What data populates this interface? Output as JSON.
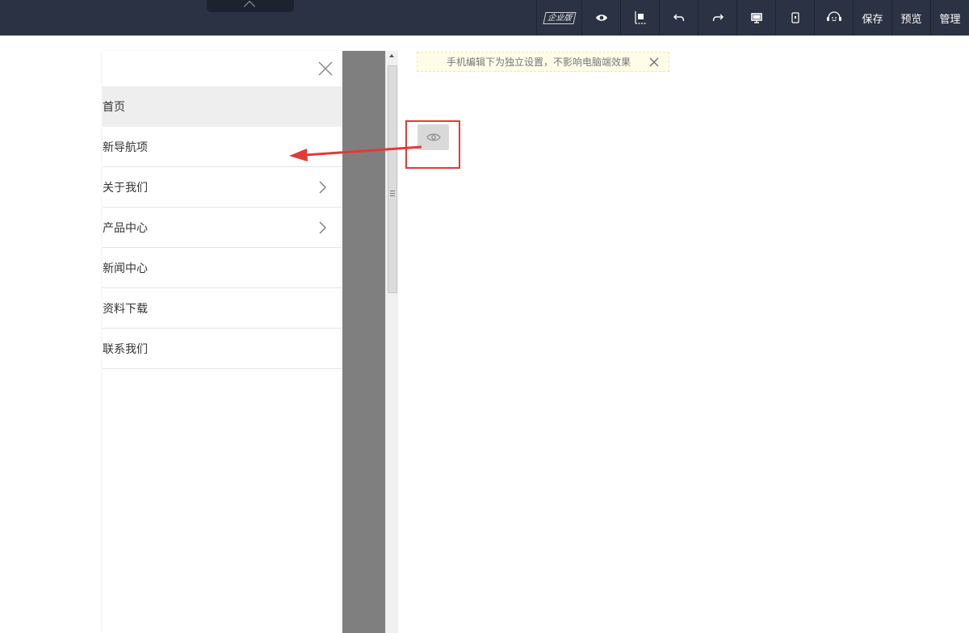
{
  "toolbar": {
    "badge_label": "企业版",
    "save_label": "保存",
    "preview_label": "预览",
    "manage_label": "管理"
  },
  "icons": {
    "eye": "eye-icon",
    "layout": "layout-icon",
    "undo": "undo-icon",
    "redo": "redo-icon",
    "desktop": "desktop-icon",
    "mobile": "mobile-icon",
    "support": "support-icon"
  },
  "nav": {
    "items": [
      {
        "label": "首页",
        "active": true,
        "has_arrow": false
      },
      {
        "label": "新导航项",
        "active": false,
        "has_arrow": false
      },
      {
        "label": "关于我们",
        "active": false,
        "has_arrow": true
      },
      {
        "label": "产品中心",
        "active": false,
        "has_arrow": true
      },
      {
        "label": "新闻中心",
        "active": false,
        "has_arrow": false
      },
      {
        "label": "资料下载",
        "active": false,
        "has_arrow": false
      },
      {
        "label": "联系我们",
        "active": false,
        "has_arrow": false
      }
    ]
  },
  "notice": {
    "text": "手机编辑下为独立设置，不影响电脑端效果"
  },
  "colors": {
    "toolbar_bg": "#2b3243",
    "highlight": "#e53935",
    "notice_bg": "#fffde8"
  }
}
